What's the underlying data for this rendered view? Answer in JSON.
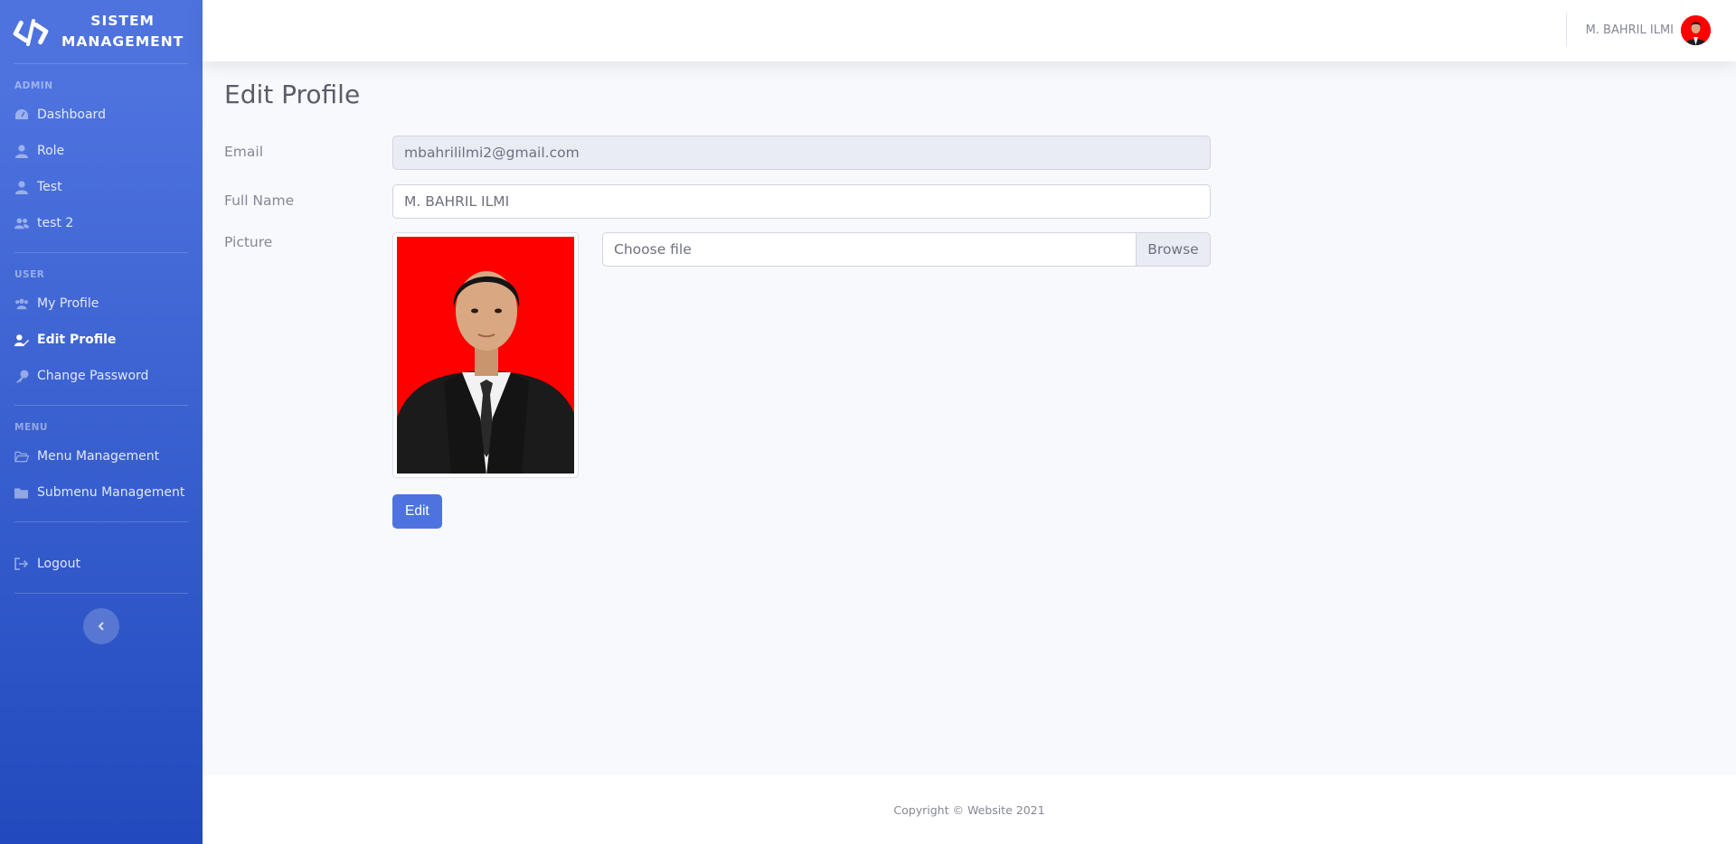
{
  "brand": {
    "title_line1": "SISTEM",
    "title_line2": "MANAGEMENT",
    "icon": "code-icon"
  },
  "sidebar": {
    "sections": [
      {
        "heading": "ADMIN",
        "items": [
          {
            "label": "Dashboard",
            "icon": "tachometer-icon",
            "active": false
          },
          {
            "label": "Role",
            "icon": "user-icon",
            "active": false
          },
          {
            "label": "Test",
            "icon": "user-icon",
            "active": false
          },
          {
            "label": "test 2",
            "icon": "users-icon",
            "active": false
          }
        ]
      },
      {
        "heading": "USER",
        "items": [
          {
            "label": "My Profile",
            "icon": "users-icon",
            "active": false
          },
          {
            "label": "Edit Profile",
            "icon": "user-edit-icon",
            "active": true
          },
          {
            "label": "Change Password",
            "icon": "key-icon",
            "active": false
          }
        ]
      },
      {
        "heading": "MENU",
        "items": [
          {
            "label": "Menu Management",
            "icon": "folder-open-icon",
            "active": false
          },
          {
            "label": "Submenu Management",
            "icon": "folder-icon",
            "active": false
          }
        ]
      }
    ],
    "logout": {
      "label": "Logout",
      "icon": "sign-out-icon"
    },
    "toggle_icon": "chevron-left-icon"
  },
  "topbar": {
    "user_name": "M. BAHRIL ILMI"
  },
  "page": {
    "title": "Edit Profile",
    "email_label": "Email",
    "email_value": "mbahrililmi2@gmail.com",
    "fullname_label": "Full Name",
    "fullname_value": "M. BAHRIL ILMI",
    "picture_label": "Picture",
    "file_placeholder": "Choose file",
    "browse_label": "Browse",
    "edit_button": "Edit"
  },
  "footer": {
    "copyright": "Copyright © Website 2021"
  },
  "colors": {
    "primary": "#4e73df",
    "primary_dark": "#224abe",
    "photo_bg": "#ff0000"
  }
}
